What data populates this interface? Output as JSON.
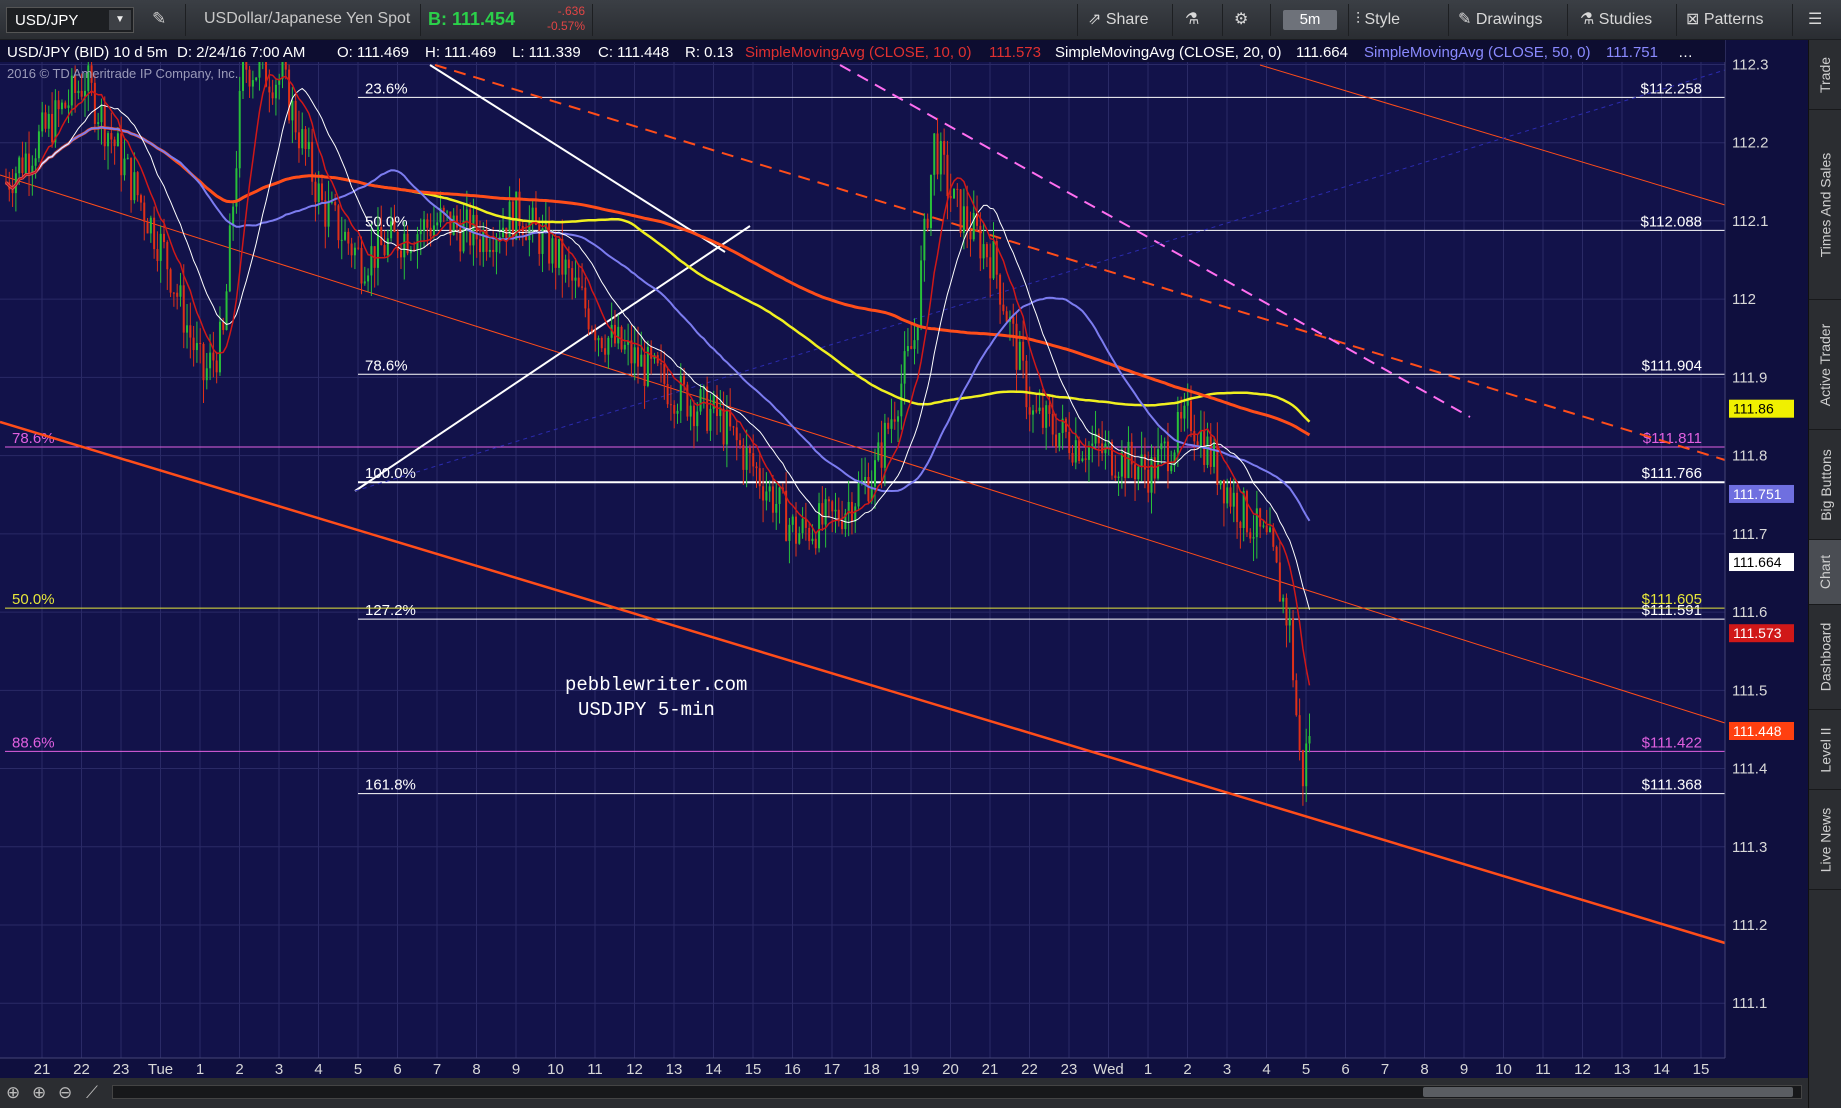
{
  "toolbar": {
    "symbol": "USD/JPY",
    "description": "USDollar/Japanese Yen Spot",
    "bid": "B: 111.454",
    "change": "-.636",
    "change_pct": "-0.57%",
    "share": "Share",
    "period": "5m",
    "style": "Style",
    "drawings": "Drawings",
    "studies": "Studies",
    "patterns": "Patterns"
  },
  "header": {
    "title": "USD/JPY (BID) 10 d 5m",
    "date": "D: 2/24/16 7:00 AM",
    "open": "O: 111.469",
    "high": "H: 111.469",
    "low": "L: 111.339",
    "close": "C: 111.448",
    "range": "R: 0.13",
    "sma10": "SimpleMovingAvg (CLOSE, 10, 0)",
    "sma10_val": "111.573",
    "sma20": "SimpleMovingAvg (CLOSE, 20, 0)",
    "sma20_val": "111.664",
    "sma50": "SimpleMovingAvg (CLOSE, 50, 0)",
    "sma50_val": "111.751",
    "copyright": "2016 © TD Ameritrade IP Company, Inc."
  },
  "side_tabs": [
    "Trade",
    "Times And Sales",
    "Active Trader",
    "Big Buttons",
    "Chart",
    "Dashboard",
    "Level II",
    "Live News"
  ],
  "chart_data": {
    "type": "candlestick",
    "title": "pebblewriter.com",
    "subtitle": "USDJPY 5-min",
    "ylim": [
      111.03,
      112.33
    ],
    "y_ticks": [
      112.3,
      112.2,
      112.1,
      112,
      111.9,
      111.8,
      111.7,
      111.6,
      111.5,
      111.4,
      111.3,
      111.2,
      111.1
    ],
    "x_ticks": [
      "21",
      "22",
      "23",
      "Tue",
      "1",
      "2",
      "3",
      "4",
      "5",
      "6",
      "7",
      "8",
      "9",
      "10",
      "11",
      "12",
      "13",
      "14",
      "15",
      "16",
      "17",
      "18",
      "19",
      "20",
      "21",
      "22",
      "23",
      "Wed",
      "1",
      "2",
      "3",
      "4",
      "5",
      "6",
      "7",
      "8",
      "9",
      "10",
      "11",
      "12",
      "13",
      "14",
      "15"
    ],
    "price_path": [
      [
        0,
        112.15
      ],
      [
        2,
        112.28
      ],
      [
        4,
        112.06
      ],
      [
        5,
        111.9
      ],
      [
        5.5,
        111.95
      ],
      [
        6,
        112.3
      ],
      [
        7,
        112.28
      ],
      [
        8,
        112.12
      ],
      [
        9,
        112.05
      ],
      [
        10,
        112.08
      ],
      [
        11,
        112.1
      ],
      [
        12,
        112.08
      ],
      [
        13,
        112.11
      ],
      [
        14,
        112.05
      ],
      [
        15,
        111.96
      ],
      [
        16,
        111.92
      ],
      [
        17,
        111.88
      ],
      [
        18,
        111.85
      ],
      [
        19,
        111.78
      ],
      [
        20,
        111.7
      ],
      [
        21,
        111.72
      ],
      [
        22,
        111.78
      ],
      [
        23,
        111.95
      ],
      [
        23.5,
        112.2
      ],
      [
        24,
        112.12
      ],
      [
        25,
        112.05
      ],
      [
        26,
        111.85
      ],
      [
        27,
        111.82
      ],
      [
        28,
        111.8
      ],
      [
        29,
        111.78
      ],
      [
        30,
        111.85
      ],
      [
        31,
        111.75
      ],
      [
        32,
        111.68
      ],
      [
        32.5,
        111.58
      ],
      [
        32.8,
        111.38
      ],
      [
        33,
        111.45
      ]
    ],
    "fib_levels": [
      {
        "label": "23.6%",
        "value": "112.258",
        "color": "#ffffff"
      },
      {
        "label": "50.0%",
        "value": "112.088",
        "color": "#ffffff"
      },
      {
        "label": "78.6%",
        "value": "111.904",
        "color": "#ffffff"
      },
      {
        "label": "100.0%",
        "value": "111.766",
        "color": "#ffffff"
      },
      {
        "label": "127.2%",
        "value": "111.591",
        "color": "#ffffff"
      },
      {
        "label": "161.8%",
        "value": "111.368",
        "color": "#ffffff"
      },
      {
        "label": "78.6%",
        "value": "111.811",
        "color": "#e060e0"
      },
      {
        "label": "50.0%",
        "value": "111.605",
        "color": "#e6e63a"
      },
      {
        "label": "88.6%",
        "value": "111.422",
        "color": "#e060e0"
      }
    ],
    "price_tags": [
      {
        "value": "111.86",
        "bg": "#f0f000",
        "fg": "#000000"
      },
      {
        "value": "111.751",
        "bg": "#6f6fe0",
        "fg": "#ffffff"
      },
      {
        "value": "111.664",
        "bg": "#ffffff",
        "fg": "#000000"
      },
      {
        "value": "111.573",
        "bg": "#d01818",
        "fg": "#ffffff"
      },
      {
        "value": "111.448",
        "bg": "#ff4010",
        "fg": "#ffffff"
      }
    ],
    "colors": {
      "up": "#28c03a",
      "down": "#e03018",
      "sma10": "#d01818",
      "sma20": "#ffffff",
      "sma50": "#7c7cf0",
      "sma200": "#f0f020",
      "trend": "#ff4d1a",
      "magenta": "#ff6ef0"
    }
  }
}
